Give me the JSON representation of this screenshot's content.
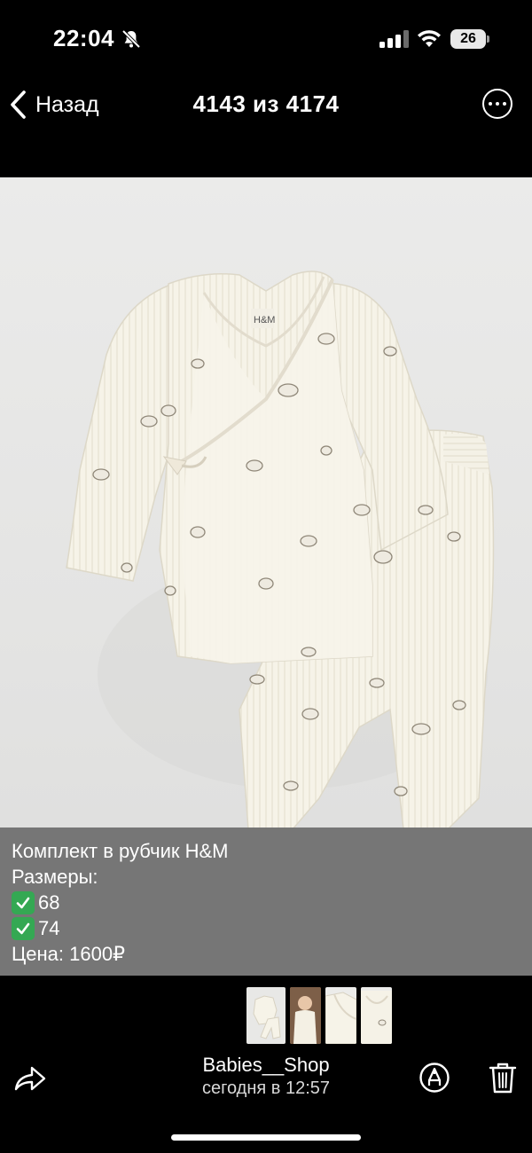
{
  "status_bar": {
    "time": "22:04",
    "battery_level": "26",
    "icons": [
      "bell-muted-icon",
      "cellular-signal-icon",
      "wifi-icon",
      "battery-icon"
    ]
  },
  "nav": {
    "back_label": "Назад",
    "counter": "4143 из 4174",
    "more_icon": "ellipsis-circle-icon"
  },
  "photo": {
    "brand_tag": "H&M"
  },
  "caption": {
    "title": "Комплект в рубчик H&M",
    "sizes_label": "Размеры:",
    "sizes": [
      "68",
      "74"
    ],
    "price": "Цена: 1600₽"
  },
  "thumbnails": [
    "outfit-flatlay-thumbnail",
    "baby-photo-thumbnail",
    "outfit-closeup-thumbnail",
    "outfit-detail-thumbnail"
  ],
  "footer": {
    "title": "Babies__Shop",
    "subtitle": "сегодня в 12:57"
  },
  "colors": {
    "background": "#000000",
    "caption_bg": "#6e6e6e",
    "check_green": "#34a853",
    "garment": "#f6f3e8"
  }
}
